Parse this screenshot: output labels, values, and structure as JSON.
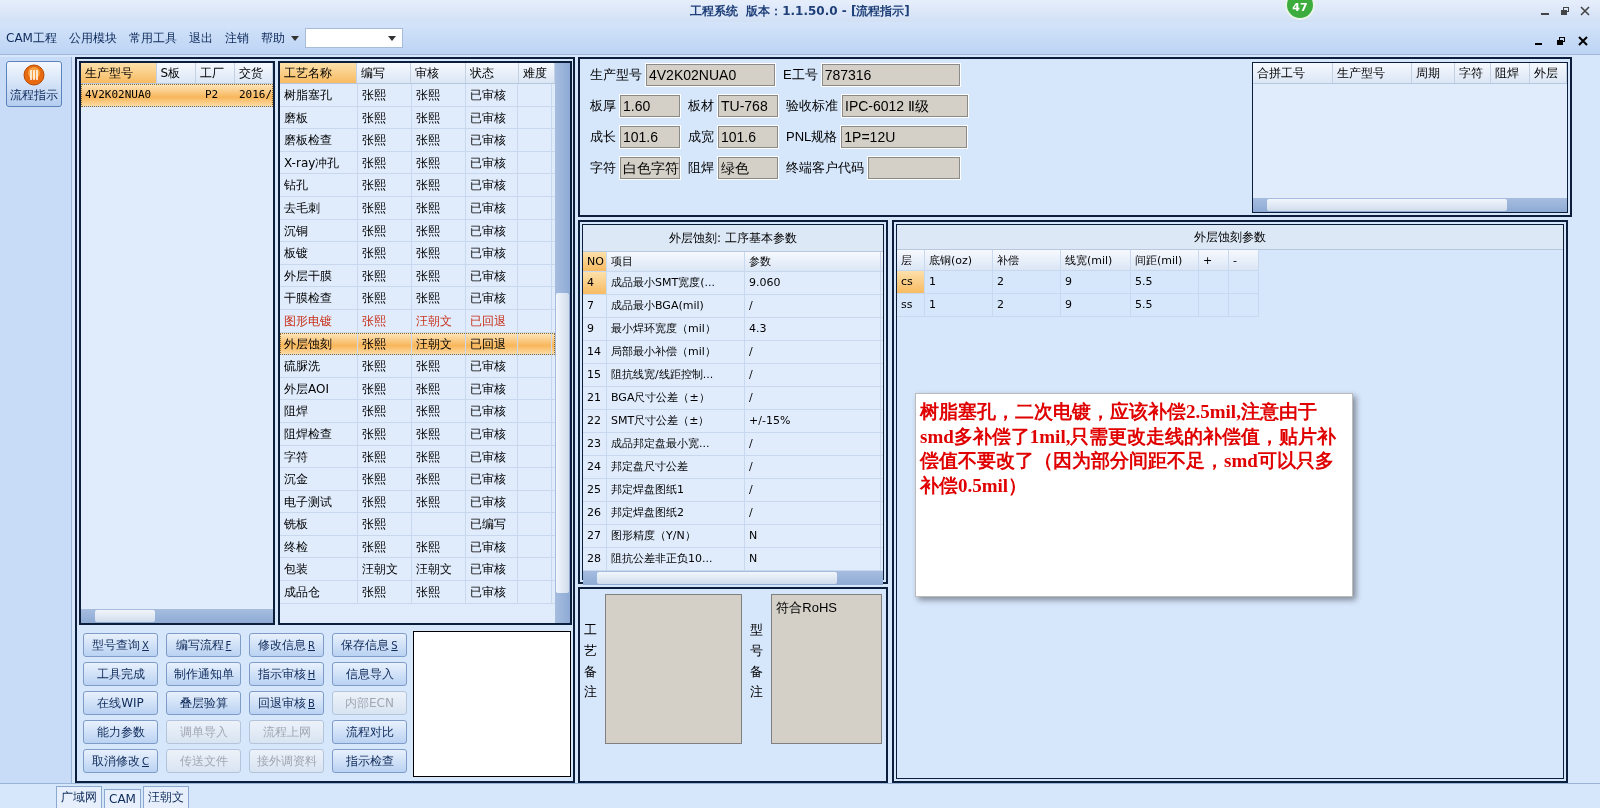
{
  "window": {
    "title": "工程系统",
    "version": "版本：1.1.50.0 - [流程指示]",
    "badge": "47"
  },
  "menu": [
    {
      "label": "CAM工程"
    },
    {
      "label": "公用模块"
    },
    {
      "label": "常用工具"
    },
    {
      "label": "退出"
    },
    {
      "label": "注销"
    },
    {
      "label": "帮助",
      "dropdown": true
    }
  ],
  "nav": [
    {
      "label": "流程指示",
      "selected": true
    }
  ],
  "orders": {
    "columns": [
      "生产型号",
      "S板",
      "工厂",
      "交货"
    ],
    "rows": [
      {
        "cells": [
          "4V2K02NUA0",
          "",
          "P2",
          "2016/"
        ],
        "selected": true
      }
    ]
  },
  "processes": {
    "columns": [
      "工艺名称",
      "编写",
      "审核",
      "状态",
      "难度"
    ],
    "rows": [
      {
        "cells": [
          "树脂塞孔",
          "张熙",
          "张熙",
          "已审核",
          ""
        ],
        "flagged": false,
        "selected": false
      },
      {
        "cells": [
          "磨板",
          "张熙",
          "张熙",
          "已审核",
          ""
        ],
        "flagged": false,
        "selected": false
      },
      {
        "cells": [
          "磨板检查",
          "张熙",
          "张熙",
          "已审核",
          ""
        ],
        "flagged": false,
        "selected": false
      },
      {
        "cells": [
          "X-ray冲孔",
          "张熙",
          "张熙",
          "已审核",
          ""
        ],
        "flagged": false,
        "selected": false
      },
      {
        "cells": [
          "钻孔",
          "张熙",
          "张熙",
          "已审核",
          ""
        ],
        "flagged": false,
        "selected": false
      },
      {
        "cells": [
          "去毛刺",
          "张熙",
          "张熙",
          "已审核",
          ""
        ],
        "flagged": false,
        "selected": false
      },
      {
        "cells": [
          "沉铜",
          "张熙",
          "张熙",
          "已审核",
          ""
        ],
        "flagged": false,
        "selected": false
      },
      {
        "cells": [
          "板镀",
          "张熙",
          "张熙",
          "已审核",
          ""
        ],
        "flagged": false,
        "selected": false
      },
      {
        "cells": [
          "外层干膜",
          "张熙",
          "张熙",
          "已审核",
          ""
        ],
        "flagged": false,
        "selected": false
      },
      {
        "cells": [
          "干膜检查",
          "张熙",
          "张熙",
          "已审核",
          ""
        ],
        "flagged": false,
        "selected": false
      },
      {
        "cells": [
          "图形电镀",
          "张熙",
          "汪朝文",
          "已回退",
          ""
        ],
        "flagged": true,
        "selected": false
      },
      {
        "cells": [
          "外层蚀刻",
          "张熙",
          "汪朝文",
          "已回退",
          ""
        ],
        "flagged": false,
        "selected": true
      },
      {
        "cells": [
          "硫脲洗",
          "张熙",
          "张熙",
          "已审核",
          ""
        ],
        "flagged": false,
        "selected": false
      },
      {
        "cells": [
          "外层AOI",
          "张熙",
          "张熙",
          "已审核",
          ""
        ],
        "flagged": false,
        "selected": false
      },
      {
        "cells": [
          "阻焊",
          "张熙",
          "张熙",
          "已审核",
          ""
        ],
        "flagged": false,
        "selected": false
      },
      {
        "cells": [
          "阻焊检查",
          "张熙",
          "张熙",
          "已审核",
          ""
        ],
        "flagged": false,
        "selected": false
      },
      {
        "cells": [
          "字符",
          "张熙",
          "张熙",
          "已审核",
          ""
        ],
        "flagged": false,
        "selected": false
      },
      {
        "cells": [
          "沉金",
          "张熙",
          "张熙",
          "已审核",
          ""
        ],
        "flagged": false,
        "selected": false
      },
      {
        "cells": [
          "电子测试",
          "张熙",
          "张熙",
          "已审核",
          ""
        ],
        "flagged": false,
        "selected": false
      },
      {
        "cells": [
          "铣板",
          "张熙",
          "",
          "已编写",
          ""
        ],
        "flagged": false,
        "selected": false
      },
      {
        "cells": [
          "终检",
          "张熙",
          "张熙",
          "已审核",
          ""
        ],
        "flagged": false,
        "selected": false
      },
      {
        "cells": [
          "包装",
          "汪朝文",
          "汪朝文",
          "已审核",
          ""
        ],
        "flagged": false,
        "selected": false
      },
      {
        "cells": [
          "成品仓",
          "张熙",
          "张熙",
          "已审核",
          ""
        ],
        "flagged": false,
        "selected": false
      }
    ]
  },
  "buttons": [
    {
      "label": "型号查询",
      "shortcut": "X",
      "disabled": false
    },
    {
      "label": "编写流程",
      "shortcut": "F",
      "disabled": false
    },
    {
      "label": "修改信息",
      "shortcut": "R",
      "disabled": false
    },
    {
      "label": "保存信息",
      "shortcut": "S",
      "disabled": false
    },
    {
      "label": "工具完成",
      "disabled": false
    },
    {
      "label": "制作通知单",
      "disabled": false
    },
    {
      "label": "指示审核",
      "shortcut": "H",
      "disabled": false
    },
    {
      "label": "信息导入",
      "disabled": false
    },
    {
      "label": "在线WIP",
      "disabled": false
    },
    {
      "label": "叠层验算",
      "disabled": false
    },
    {
      "label": "回退审核",
      "shortcut": "B",
      "disabled": false
    },
    {
      "label": "内部ECN",
      "disabled": true
    },
    {
      "label": "能力参数",
      "disabled": false
    },
    {
      "label": "调单导入",
      "disabled": true
    },
    {
      "label": "流程上网",
      "disabled": true
    },
    {
      "label": "流程对比",
      "disabled": false
    },
    {
      "label": "取消修改",
      "shortcut": "C",
      "disabled": false
    },
    {
      "label": "传送文件",
      "disabled": true
    },
    {
      "label": "接外调资料",
      "disabled": true
    },
    {
      "label": "指示检查",
      "disabled": false
    }
  ],
  "info": [
    [
      {
        "label": "生产型号",
        "value": "4V2K02NUA0"
      },
      {
        "label": "E工号",
        "value": "787316"
      }
    ],
    [
      {
        "label": "板厚",
        "value": "1.60"
      },
      {
        "label": "板材",
        "value": "TU-768"
      },
      {
        "label": "验收标准",
        "value": "IPC-6012 Ⅱ级"
      }
    ],
    [
      {
        "label": "成长",
        "value": "101.6"
      },
      {
        "label": "成宽",
        "value": "101.6"
      },
      {
        "label": "PNL规格",
        "value": "1P=12U"
      }
    ],
    [
      {
        "label": "字符",
        "value": "白色字符"
      },
      {
        "label": "阻焊",
        "value": "绿色"
      },
      {
        "label": "终端客户代码"
      }
    ]
  ],
  "combined": {
    "columns": [
      "合拼工号",
      "生产型号",
      "周期",
      "字符",
      "阻焊",
      "外层"
    ]
  },
  "params": {
    "title": "外层蚀刻: 工序基本参数",
    "columns": [
      "NO",
      "项目",
      "参数"
    ],
    "rows": [
      {
        "cells": [
          "4",
          "成品最小SMT宽度(...",
          "9.060"
        ],
        "selected": true
      },
      {
        "cells": [
          "7",
          "成品最小BGA(mil)",
          "/"
        ],
        "selected": false
      },
      {
        "cells": [
          "9",
          "最小焊环宽度（mil）",
          "4.3"
        ],
        "selected": false
      },
      {
        "cells": [
          "14",
          "局部最小补偿（mil）",
          "/"
        ],
        "selected": false
      },
      {
        "cells": [
          "15",
          "阻抗线宽/线距控制...",
          "/"
        ],
        "selected": false
      },
      {
        "cells": [
          "21",
          "BGA尺寸公差（±）",
          "/"
        ],
        "selected": false
      },
      {
        "cells": [
          "22",
          "SMT尺寸公差（±）",
          "+/-15%"
        ],
        "selected": false
      },
      {
        "cells": [
          "23",
          "成品邦定盘最小宽...",
          "/"
        ],
        "selected": false
      },
      {
        "cells": [
          "24",
          "邦定盘尺寸公差",
          "/"
        ],
        "selected": false
      },
      {
        "cells": [
          "25",
          "邦定焊盘图纸1",
          "/"
        ],
        "selected": false
      },
      {
        "cells": [
          "26",
          "邦定焊盘图纸2",
          "/"
        ],
        "selected": false
      },
      {
        "cells": [
          "27",
          "图形精度（Y/N）",
          "N"
        ],
        "selected": false
      },
      {
        "cells": [
          "28",
          "阻抗公差非正负10...",
          "N"
        ],
        "selected": false
      }
    ]
  },
  "notes": [
    {
      "label": "工艺备注"
    },
    {
      "label": "型号备注",
      "value": "符合RoHS"
    }
  ],
  "etch": {
    "title": "外层蚀刻参数",
    "columns": [
      "层",
      "底铜(oz)",
      "补偿",
      "线宽(mil)",
      "间距(mil)",
      "+",
      "-"
    ],
    "rows": [
      {
        "cells": [
          "cs",
          "1",
          "2",
          "9",
          "5.5",
          "",
          ""
        ],
        "selected": true
      },
      {
        "cells": [
          "ss",
          "1",
          "2",
          "9",
          "5.5",
          "",
          ""
        ],
        "selected": false
      }
    ]
  },
  "popup_note": "树脂塞孔，二次电镀，应该补偿2.5mil,注意由于smd多补偿了1mil,只需更改走线的补偿值，贴片补偿值不要改了（因为部分间距不足，smd可以只多补偿0.5mil）",
  "status_tabs": [
    {
      "label": "广域网"
    },
    {
      "label": "CAM"
    },
    {
      "label": "汪朝文"
    }
  ]
}
